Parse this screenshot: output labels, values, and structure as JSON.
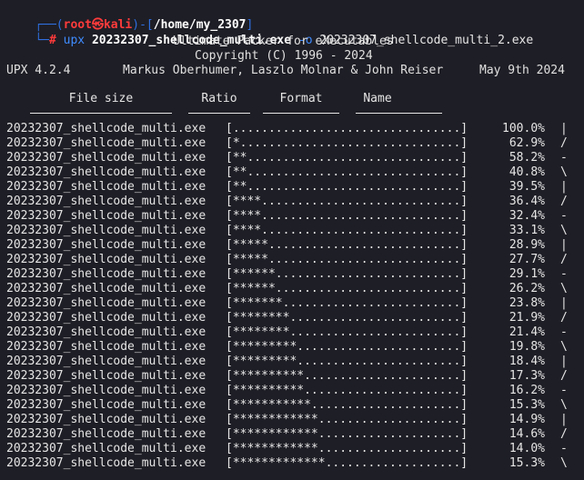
{
  "prompt": {
    "corner_top": "┌──(",
    "user": "root",
    "skull": "㉿",
    "host": "kali",
    "mid": ")-[",
    "cwd": "/home/my_2307",
    "close": "]",
    "corner_bottom": "└─",
    "symbol": "#"
  },
  "command": {
    "name": "upx",
    "arg1": "20232307_shellcode_multi.exe",
    "option": "-o",
    "arg2": "20232307_shellcode_multi_2.exe"
  },
  "banner": {
    "title": "Ultimate Packer for eXecutables",
    "copyright": "Copyright (C) 1996 - 2024",
    "version": "UPX 4.2.4",
    "authors": "Markus Oberhumer, Laszlo Molnar & John Reiser",
    "date": "May 9th 2024"
  },
  "table_headers": {
    "file_size": "File size",
    "ratio": "Ratio",
    "format": "Format",
    "name": "Name"
  },
  "rows": [
    {
      "file": "20232307_shellcode_multi.exe",
      "bar": "[................................]",
      "pct": "100.0%",
      "spin": "|"
    },
    {
      "file": "20232307_shellcode_multi.exe",
      "bar": "[*...............................]",
      "pct": "62.9%",
      "spin": "/"
    },
    {
      "file": "20232307_shellcode_multi.exe",
      "bar": "[**..............................]",
      "pct": "58.2%",
      "spin": "-"
    },
    {
      "file": "20232307_shellcode_multi.exe",
      "bar": "[**..............................]",
      "pct": "40.8%",
      "spin": "\\"
    },
    {
      "file": "20232307_shellcode_multi.exe",
      "bar": "[**..............................]",
      "pct": "39.5%",
      "spin": "|"
    },
    {
      "file": "20232307_shellcode_multi.exe",
      "bar": "[****............................]",
      "pct": "36.4%",
      "spin": "/"
    },
    {
      "file": "20232307_shellcode_multi.exe",
      "bar": "[****............................]",
      "pct": "32.4%",
      "spin": "-"
    },
    {
      "file": "20232307_shellcode_multi.exe",
      "bar": "[****............................]",
      "pct": "33.1%",
      "spin": "\\"
    },
    {
      "file": "20232307_shellcode_multi.exe",
      "bar": "[*****...........................]",
      "pct": "28.9%",
      "spin": "|"
    },
    {
      "file": "20232307_shellcode_multi.exe",
      "bar": "[*****...........................]",
      "pct": "27.7%",
      "spin": "/"
    },
    {
      "file": "20232307_shellcode_multi.exe",
      "bar": "[******..........................]",
      "pct": "29.1%",
      "spin": "-"
    },
    {
      "file": "20232307_shellcode_multi.exe",
      "bar": "[******..........................]",
      "pct": "26.2%",
      "spin": "\\"
    },
    {
      "file": "20232307_shellcode_multi.exe",
      "bar": "[*******.........................]",
      "pct": "23.8%",
      "spin": "|"
    },
    {
      "file": "20232307_shellcode_multi.exe",
      "bar": "[********........................]",
      "pct": "21.9%",
      "spin": "/"
    },
    {
      "file": "20232307_shellcode_multi.exe",
      "bar": "[********........................]",
      "pct": "21.4%",
      "spin": "-"
    },
    {
      "file": "20232307_shellcode_multi.exe",
      "bar": "[*********.......................]",
      "pct": "19.8%",
      "spin": "\\"
    },
    {
      "file": "20232307_shellcode_multi.exe",
      "bar": "[*********.......................]",
      "pct": "18.4%",
      "spin": "|"
    },
    {
      "file": "20232307_shellcode_multi.exe",
      "bar": "[**********......................]",
      "pct": "17.3%",
      "spin": "/"
    },
    {
      "file": "20232307_shellcode_multi.exe",
      "bar": "[**********......................]",
      "pct": "16.2%",
      "spin": "-"
    },
    {
      "file": "20232307_shellcode_multi.exe",
      "bar": "[***********.....................]",
      "pct": "15.3%",
      "spin": "\\"
    },
    {
      "file": "20232307_shellcode_multi.exe",
      "bar": "[************....................]",
      "pct": "14.9%",
      "spin": "|"
    },
    {
      "file": "20232307_shellcode_multi.exe",
      "bar": "[************....................]",
      "pct": "14.6%",
      "spin": "/"
    },
    {
      "file": "20232307_shellcode_multi.exe",
      "bar": "[************....................]",
      "pct": "14.0%",
      "spin": "-"
    },
    {
      "file": "20232307_shellcode_multi.exe",
      "bar": "[*************...................]",
      "pct": "15.3%",
      "spin": "\\"
    }
  ],
  "colors": {
    "background": "#1e1e26",
    "prompt_frame": "#2f6fe0",
    "root_user": "#ff3b3b",
    "command": "#3f8cff",
    "text": "#e6e6e6"
  }
}
